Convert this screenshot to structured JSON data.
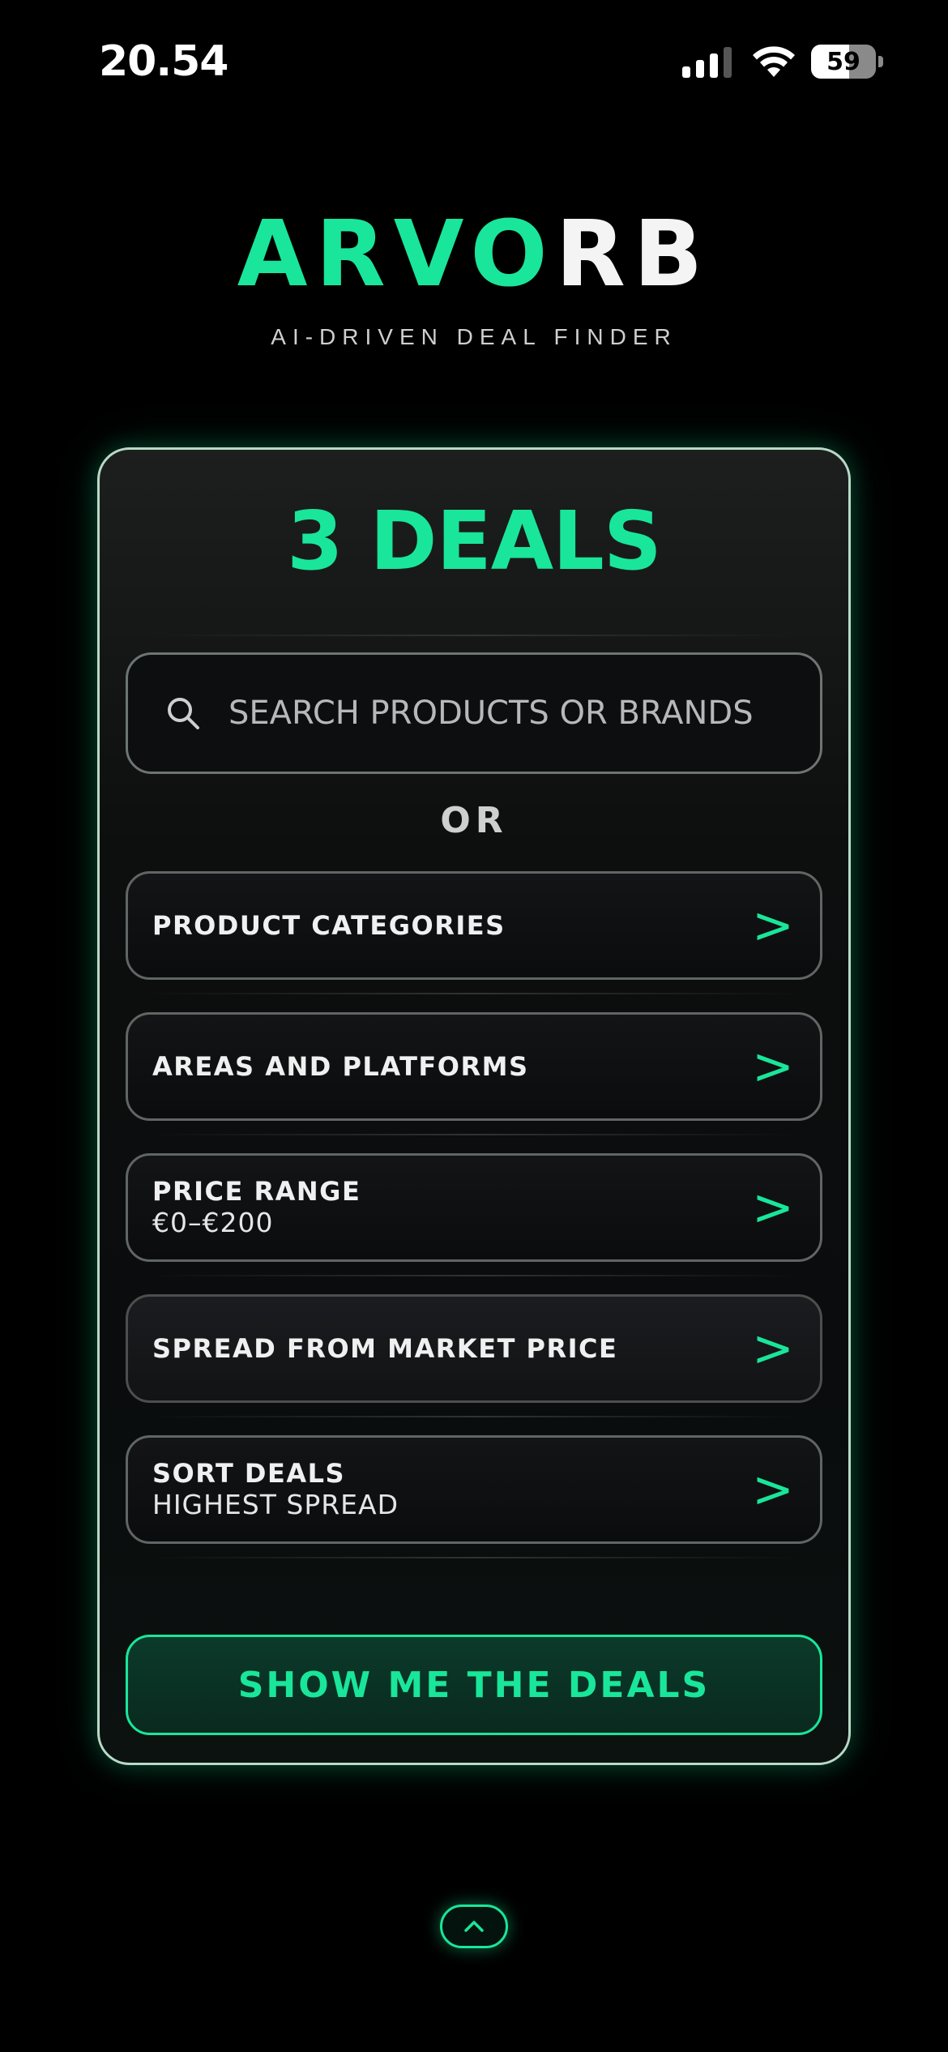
{
  "status_bar": {
    "time": "20.54",
    "battery": "59"
  },
  "brand": {
    "logo_part1": "ARVO",
    "logo_part2": "RB",
    "tagline": "AI-DRIVEN DEAL FINDER"
  },
  "card": {
    "deals_count": "3 DEALS",
    "search_placeholder": "SEARCH PRODUCTS OR BRANDS",
    "or_label": "OR",
    "options": [
      {
        "label": "PRODUCT CATEGORIES",
        "sub": ""
      },
      {
        "label": "AREAS AND PLATFORMS",
        "sub": ""
      },
      {
        "label": "PRICE RANGE",
        "sub": "€0–€200"
      },
      {
        "label": "SPREAD FROM MARKET PRICE",
        "sub": ""
      },
      {
        "label": "SORT DEALS",
        "sub": "HIGHEST SPREAD"
      }
    ],
    "chevron": ">",
    "cta_label": "SHOW ME THE DEALS"
  },
  "colors": {
    "accent": "#19e69a",
    "background": "#000000"
  },
  "icons": {
    "search": "search-icon",
    "signal": "cellular-signal-icon",
    "wifi": "wifi-icon",
    "battery": "battery-icon",
    "expand": "chevron-up-icon"
  }
}
